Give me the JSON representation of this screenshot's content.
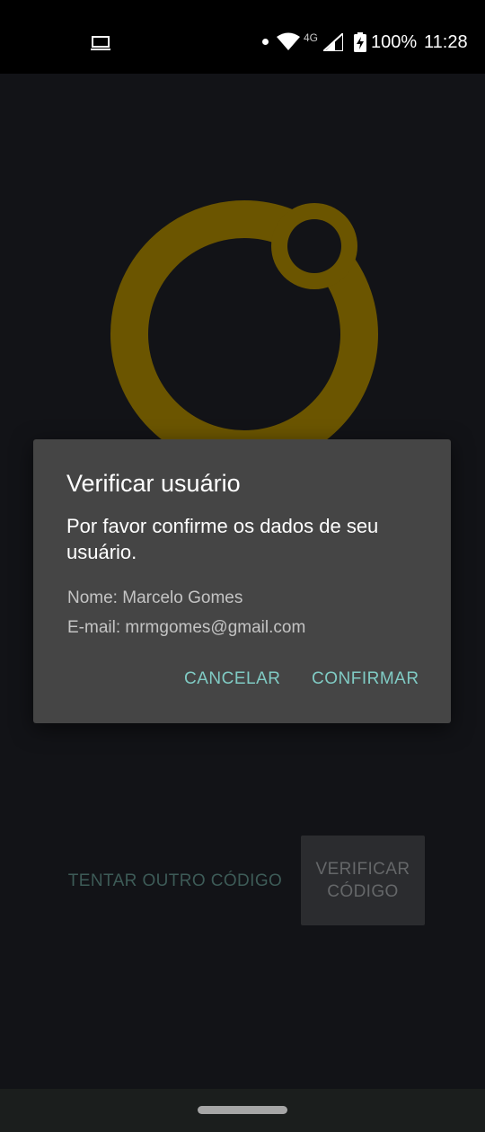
{
  "status_bar": {
    "network_type": "4G",
    "battery": "100%",
    "time": "11:28",
    "icons": [
      "cast-icon",
      "notification-dot-icon",
      "wifi-icon",
      "signal-icon",
      "battery-charging-icon"
    ]
  },
  "logo": {
    "icon": "ring-logo-icon",
    "color": "#6b5500"
  },
  "actions": {
    "retry_label": "TENTAR OUTRO CÓDIGO",
    "verify_label_line1": "VERIFICAR",
    "verify_label_line2": "CÓDIGO"
  },
  "dialog": {
    "title": "Verificar usuário",
    "message": "Por favor confirme os dados de seu usuário.",
    "name_line": "Nome: Marcelo Gomes",
    "email_line": "E-mail: mrmgomes@gmail.com",
    "cancel_label": "CANCELAR",
    "confirm_label": "CONFIRMAR",
    "accent_color": "#80cbc4"
  },
  "nav_bar": {
    "icon": "home-gesture-pill-icon"
  }
}
